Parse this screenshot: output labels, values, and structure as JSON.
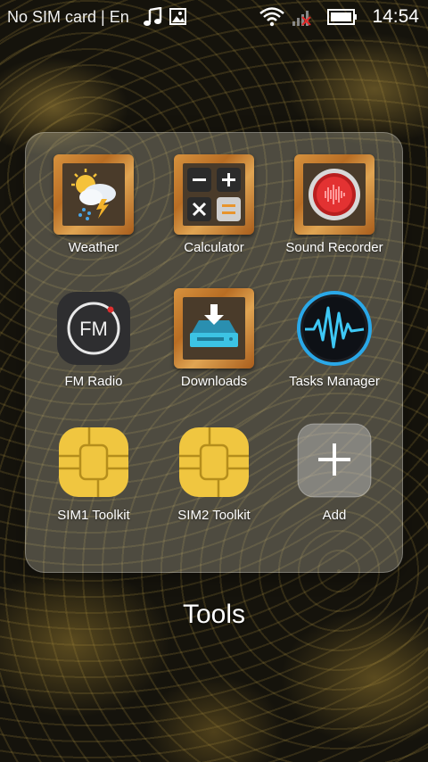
{
  "status_bar": {
    "carrier": "No SIM card | En",
    "time": "14:54",
    "icons": [
      "music-icon",
      "image-icon",
      "wifi-icon",
      "no-signal-icon",
      "battery-icon"
    ]
  },
  "folder": {
    "title": "Tools",
    "apps": [
      {
        "label": "Weather",
        "icon": "weather-icon"
      },
      {
        "label": "Calculator",
        "icon": "calculator-icon"
      },
      {
        "label": "Sound Recorder",
        "icon": "sound-recorder-icon"
      },
      {
        "label": "FM Radio",
        "icon": "fm-radio-icon"
      },
      {
        "label": "Downloads",
        "icon": "downloads-icon"
      },
      {
        "label": "Tasks Manager",
        "icon": "tasks-manager-icon"
      },
      {
        "label": "SIM1 Toolkit",
        "icon": "sim-card-icon"
      },
      {
        "label": "SIM2 Toolkit",
        "icon": "sim-card-icon"
      },
      {
        "label": "Add",
        "icon": "plus-icon"
      }
    ],
    "fm_badge": "FM"
  },
  "colors": {
    "wood": "#c27a2e",
    "recorder_red": "#d62a2a",
    "downloads_teal": "#35b8d8",
    "tasks_blue": "#2aa8e8",
    "sim_gold": "#f0c640"
  }
}
